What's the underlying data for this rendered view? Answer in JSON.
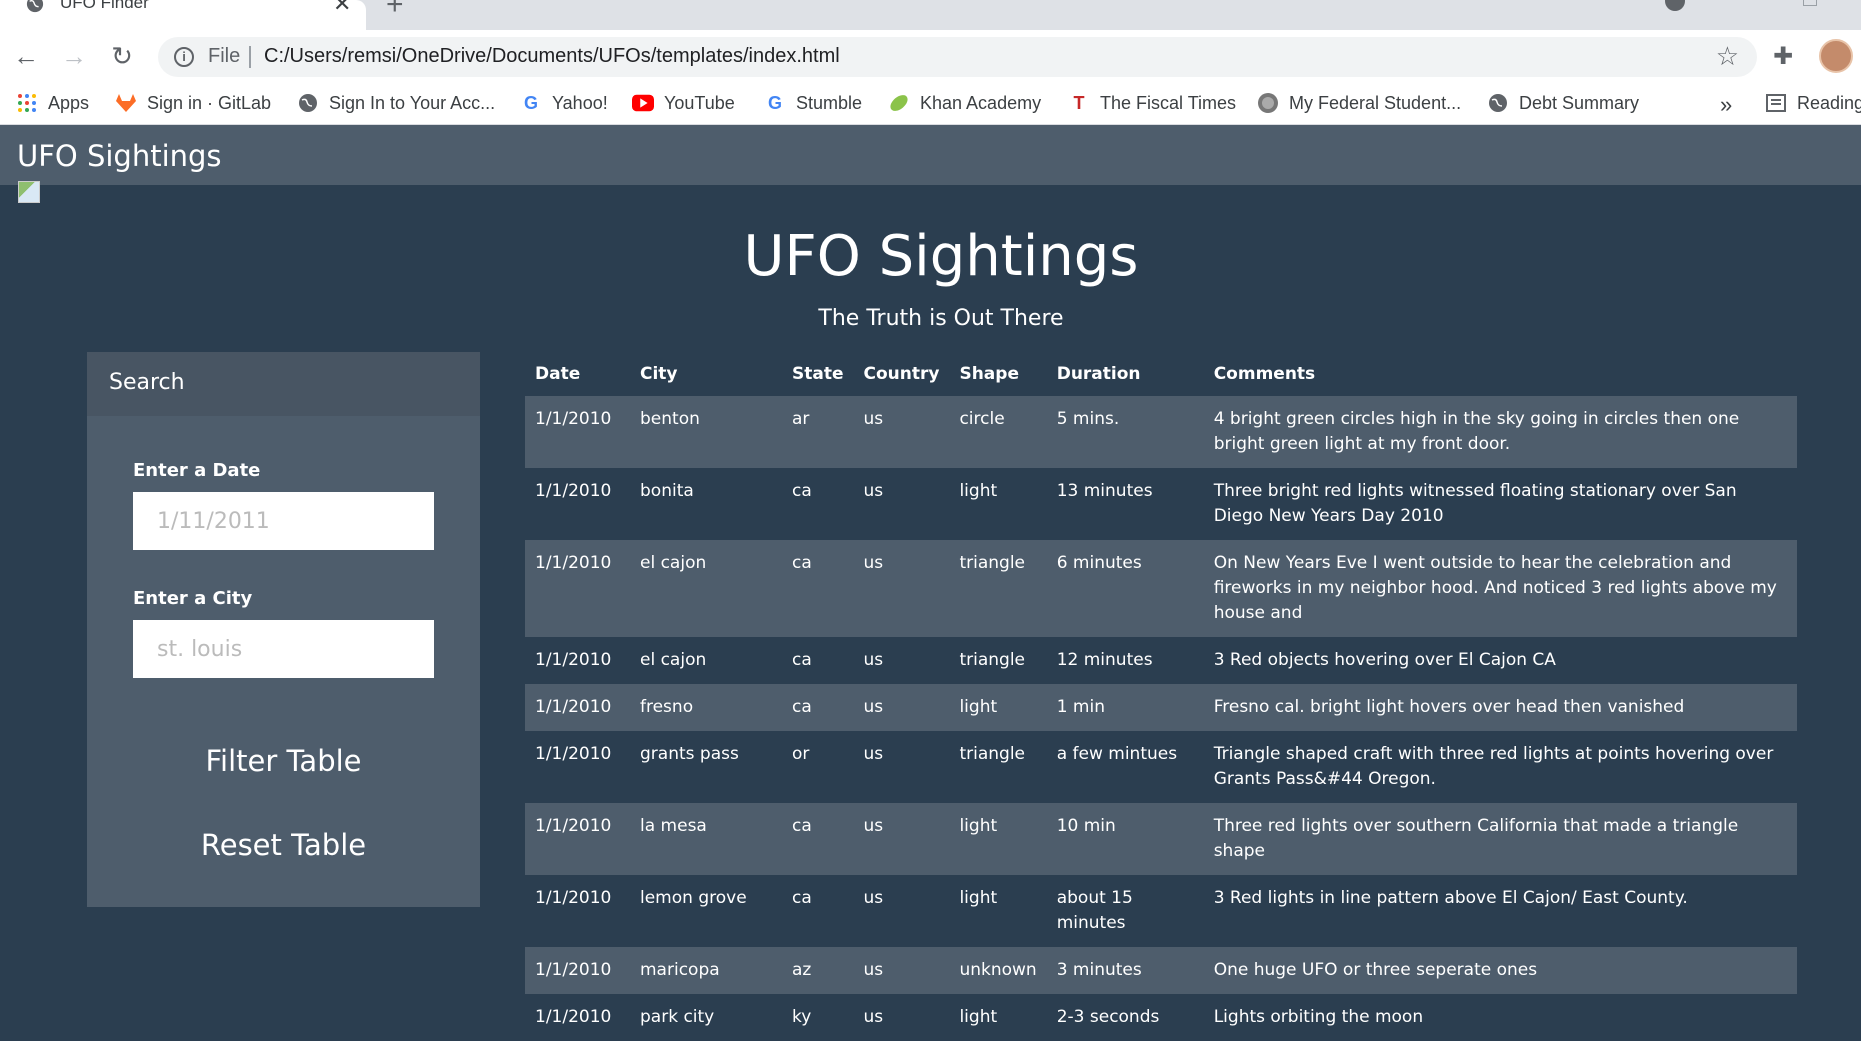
{
  "browser": {
    "tab_title": "UFO Finder",
    "url_scheme": "File",
    "url": "C:/Users/remsi/OneDrive/Documents/UFOs/templates/index.html",
    "bookmarks": [
      {
        "label": "Apps",
        "icon": "apps-grid-icon"
      },
      {
        "label": "Sign in · GitLab",
        "icon": "gitlab-icon"
      },
      {
        "label": "Sign In to Your Acc...",
        "icon": "globe-icon"
      },
      {
        "label": "Yahoo!",
        "icon": "google-icon"
      },
      {
        "label": "YouTube",
        "icon": "youtube-icon"
      },
      {
        "label": "Stumble",
        "icon": "google-icon"
      },
      {
        "label": "Khan Academy",
        "icon": "khan-leaf-icon"
      },
      {
        "label": "The Fiscal Times",
        "icon": "fiscal-times-icon"
      },
      {
        "label": "My Federal Student...",
        "icon": "seal-icon"
      },
      {
        "label": "Debt Summary",
        "icon": "globe-icon"
      }
    ],
    "overflow": "»",
    "reading_list": "Reading"
  },
  "navbar": {
    "brand": "UFO Sightings"
  },
  "hero": {
    "title": "UFO Sightings",
    "subtitle": "The Truth is Out There"
  },
  "search": {
    "heading": "Search",
    "date_label": "Enter a Date",
    "date_placeholder": "1/11/2011",
    "city_label": "Enter a City",
    "city_placeholder": "st. louis",
    "filter_button": "Filter Table",
    "reset_button": "Reset Table"
  },
  "table": {
    "headers": [
      "Date",
      "City",
      "State",
      "Country",
      "Shape",
      "Duration",
      "Comments"
    ],
    "rows": [
      [
        "1/1/2010",
        "benton",
        "ar",
        "us",
        "circle",
        "5 mins.",
        "4 bright green circles high in the sky going in circles then one bright green light at my front door."
      ],
      [
        "1/1/2010",
        "bonita",
        "ca",
        "us",
        "light",
        "13 minutes",
        "Three bright red lights witnessed floating stationary over San Diego New Years Day 2010"
      ],
      [
        "1/1/2010",
        "el cajon",
        "ca",
        "us",
        "triangle",
        "6 minutes",
        "On New Years Eve I went outside to hear the celebration and fireworks in my neighbor hood. And noticed 3 red lights above my house and"
      ],
      [
        "1/1/2010",
        "el cajon",
        "ca",
        "us",
        "triangle",
        "12 minutes",
        "3 Red objects hovering over El Cajon CA"
      ],
      [
        "1/1/2010",
        "fresno",
        "ca",
        "us",
        "light",
        "1 min",
        "Fresno cal. bright light hovers over head then vanished"
      ],
      [
        "1/1/2010",
        "grants pass",
        "or",
        "us",
        "triangle",
        "a few mintues",
        "Triangle shaped craft with three red lights at points hovering over Grants Pass&#44 Oregon."
      ],
      [
        "1/1/2010",
        "la mesa",
        "ca",
        "us",
        "light",
        "10 min",
        "Three red lights over southern California that made a triangle shape"
      ],
      [
        "1/1/2010",
        "lemon grove",
        "ca",
        "us",
        "light",
        "about 15 minutes",
        "3 Red lights in line pattern above El Cajon/ East County."
      ],
      [
        "1/1/2010",
        "maricopa",
        "az",
        "us",
        "unknown",
        "3 minutes",
        "One huge UFO or three seperate ones"
      ],
      [
        "1/1/2010",
        "park city",
        "ky",
        "us",
        "light",
        "2-3 seconds",
        "Lights orbiting the moon"
      ]
    ]
  }
}
